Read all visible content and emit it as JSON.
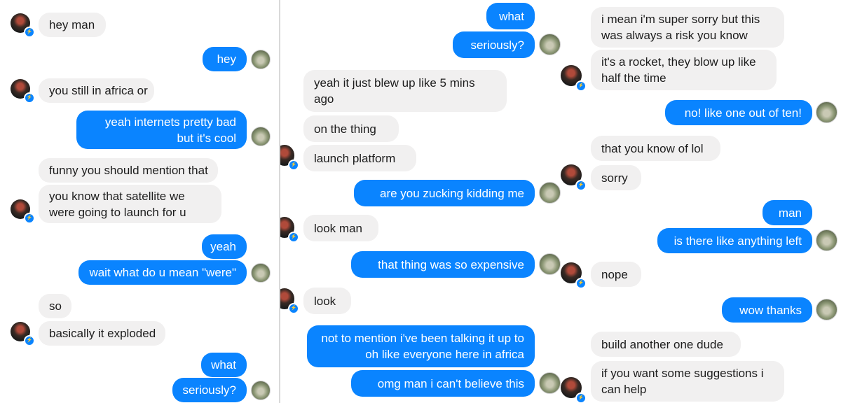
{
  "panels": [
    {
      "messages": [
        {
          "side": "in",
          "text": "hey man"
        },
        {
          "side": "out",
          "text": "hey"
        },
        {
          "side": "in",
          "text": "you still in africa or"
        },
        {
          "side": "out",
          "text": "yeah internets pretty bad but it's cool"
        },
        {
          "side": "in",
          "text": "funny you should mention that"
        },
        {
          "side": "in",
          "text": "you know that satellite we were going to launch for u"
        },
        {
          "side": "out",
          "text": "yeah"
        },
        {
          "side": "out",
          "text": "wait what do u mean \"were\""
        },
        {
          "side": "in",
          "text": "so"
        },
        {
          "side": "in",
          "text": "basically it exploded"
        },
        {
          "side": "out",
          "text": "what"
        },
        {
          "side": "out",
          "text": "seriously?"
        }
      ]
    },
    {
      "messages": [
        {
          "side": "out",
          "text": "what"
        },
        {
          "side": "out",
          "text": "seriously?"
        },
        {
          "side": "in",
          "text": "yeah it just blew up like 5 mins ago"
        },
        {
          "side": "in",
          "text": "on the thing"
        },
        {
          "side": "in",
          "text": "launch platform"
        },
        {
          "side": "out",
          "text": "are you zucking kidding me"
        },
        {
          "side": "in",
          "text": "look man"
        },
        {
          "side": "out",
          "text": "that thing was so expensive"
        },
        {
          "side": "in",
          "text": "look"
        },
        {
          "side": "out",
          "text": "not to mention i've been talking it up to oh like everyone here in africa"
        },
        {
          "side": "out",
          "text": "omg man i can't believe this"
        }
      ]
    },
    {
      "messages": [
        {
          "side": "in",
          "text": "i mean i'm super sorry but this was always a risk you know"
        },
        {
          "side": "in",
          "text": "it's a rocket, they blow up like half the time"
        },
        {
          "side": "out",
          "text": "no! like one out of ten!"
        },
        {
          "side": "in",
          "text": "that you know of lol"
        },
        {
          "side": "in",
          "text": "sorry"
        },
        {
          "side": "out",
          "text": "man"
        },
        {
          "side": "out",
          "text": "is there like anything left"
        },
        {
          "side": "in",
          "text": "nope"
        },
        {
          "side": "out",
          "text": "wow thanks"
        },
        {
          "side": "in",
          "text": "build another one dude"
        },
        {
          "side": "in",
          "text": "if you want some suggestions i can help"
        }
      ]
    }
  ],
  "colors": {
    "outgoing": "#0a84ff",
    "incoming": "#f1f0f0",
    "badge": "#0a84ff"
  },
  "icons": {
    "friend_avatar": "profile-photo",
    "my_avatar": "profile-photo",
    "badge": "messenger-badge-icon"
  }
}
